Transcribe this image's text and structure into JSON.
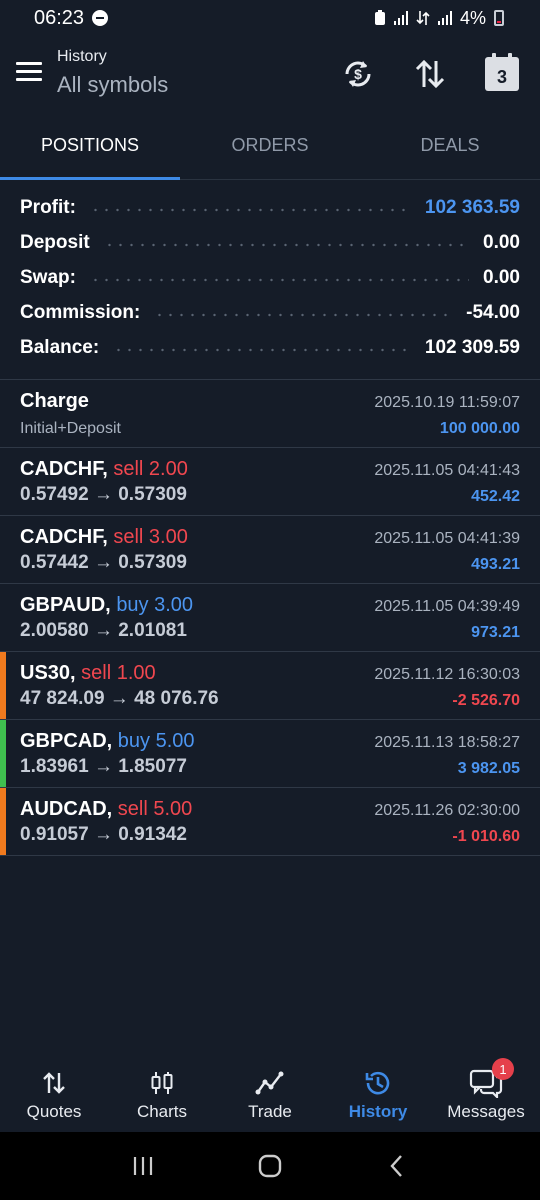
{
  "status_bar": {
    "time": "06:23",
    "battery": "4%"
  },
  "toolbar": {
    "title": "History",
    "subtitle": "All symbols",
    "calendar_day": "3"
  },
  "tabs": [
    {
      "label": "POSITIONS",
      "active": true
    },
    {
      "label": "ORDERS",
      "active": false
    },
    {
      "label": "DEALS",
      "active": false
    }
  ],
  "summary": {
    "profit_label": "Profit:",
    "profit_value": "102 363.59",
    "deposit_label": "Deposit",
    "deposit_value": "0.00",
    "swap_label": "Swap:",
    "swap_value": "0.00",
    "commission_label": "Commission:",
    "commission_value": "-54.00",
    "balance_label": "Balance:",
    "balance_value": "102 309.59"
  },
  "deals": [
    {
      "symbol": "Charge",
      "side": "",
      "detail": "Initial+Deposit",
      "time": "2025.10.19 11:59:07",
      "profit": "100 000.00",
      "profit_color": "blue",
      "bar_color": ""
    },
    {
      "symbol": "CADCHF,",
      "side": "sell 2.00",
      "side_color": "red",
      "detail": "0.57492 → 0.57309",
      "time": "2025.11.05 04:41:43",
      "profit": "452.42",
      "profit_color": "blue",
      "bar_color": ""
    },
    {
      "symbol": "CADCHF,",
      "side": "sell 3.00",
      "side_color": "red",
      "detail": "0.57442 → 0.57309",
      "time": "2025.11.05 04:41:39",
      "profit": "493.21",
      "profit_color": "blue",
      "bar_color": ""
    },
    {
      "symbol": "GBPAUD,",
      "side": "buy 3.00",
      "side_color": "blue",
      "detail": "2.00580 → 2.01081",
      "time": "2025.11.05 04:39:49",
      "profit": "973.21",
      "profit_color": "blue",
      "bar_color": ""
    },
    {
      "symbol": "US30,",
      "side": "sell 1.00",
      "side_color": "red",
      "detail": "47 824.09 → 48 076.76",
      "time": "2025.11.12 16:30:03",
      "profit": "-2 526.70",
      "profit_color": "red",
      "bar_color": "#f07a1e"
    },
    {
      "symbol": "GBPCAD,",
      "side": "buy 5.00",
      "side_color": "blue",
      "detail": "1.83961 → 1.85077",
      "time": "2025.11.13 18:58:27",
      "profit": "3 982.05",
      "profit_color": "blue",
      "bar_color": "#3fbf4f"
    },
    {
      "symbol": "AUDCAD,",
      "side": "sell 5.00",
      "side_color": "red",
      "detail": "0.91057 → 0.91342",
      "time": "2025.11.26 02:30:00",
      "profit": "-1 010.60",
      "profit_color": "red",
      "bar_color": "#f07a1e"
    }
  ],
  "bottom_nav": [
    {
      "label": "Quotes",
      "icon": "quotes-icon",
      "active": false
    },
    {
      "label": "Charts",
      "icon": "charts-icon",
      "active": false
    },
    {
      "label": "Trade",
      "icon": "trade-icon",
      "active": false
    },
    {
      "label": "History",
      "icon": "history-icon",
      "active": true
    },
    {
      "label": "Messages",
      "icon": "messages-icon",
      "active": false,
      "badge": "1"
    }
  ],
  "colors": {
    "background": "#151c28",
    "accent": "#3e8ae6",
    "profit_blue": "#4c95f0",
    "loss_red": "#f0474f"
  }
}
